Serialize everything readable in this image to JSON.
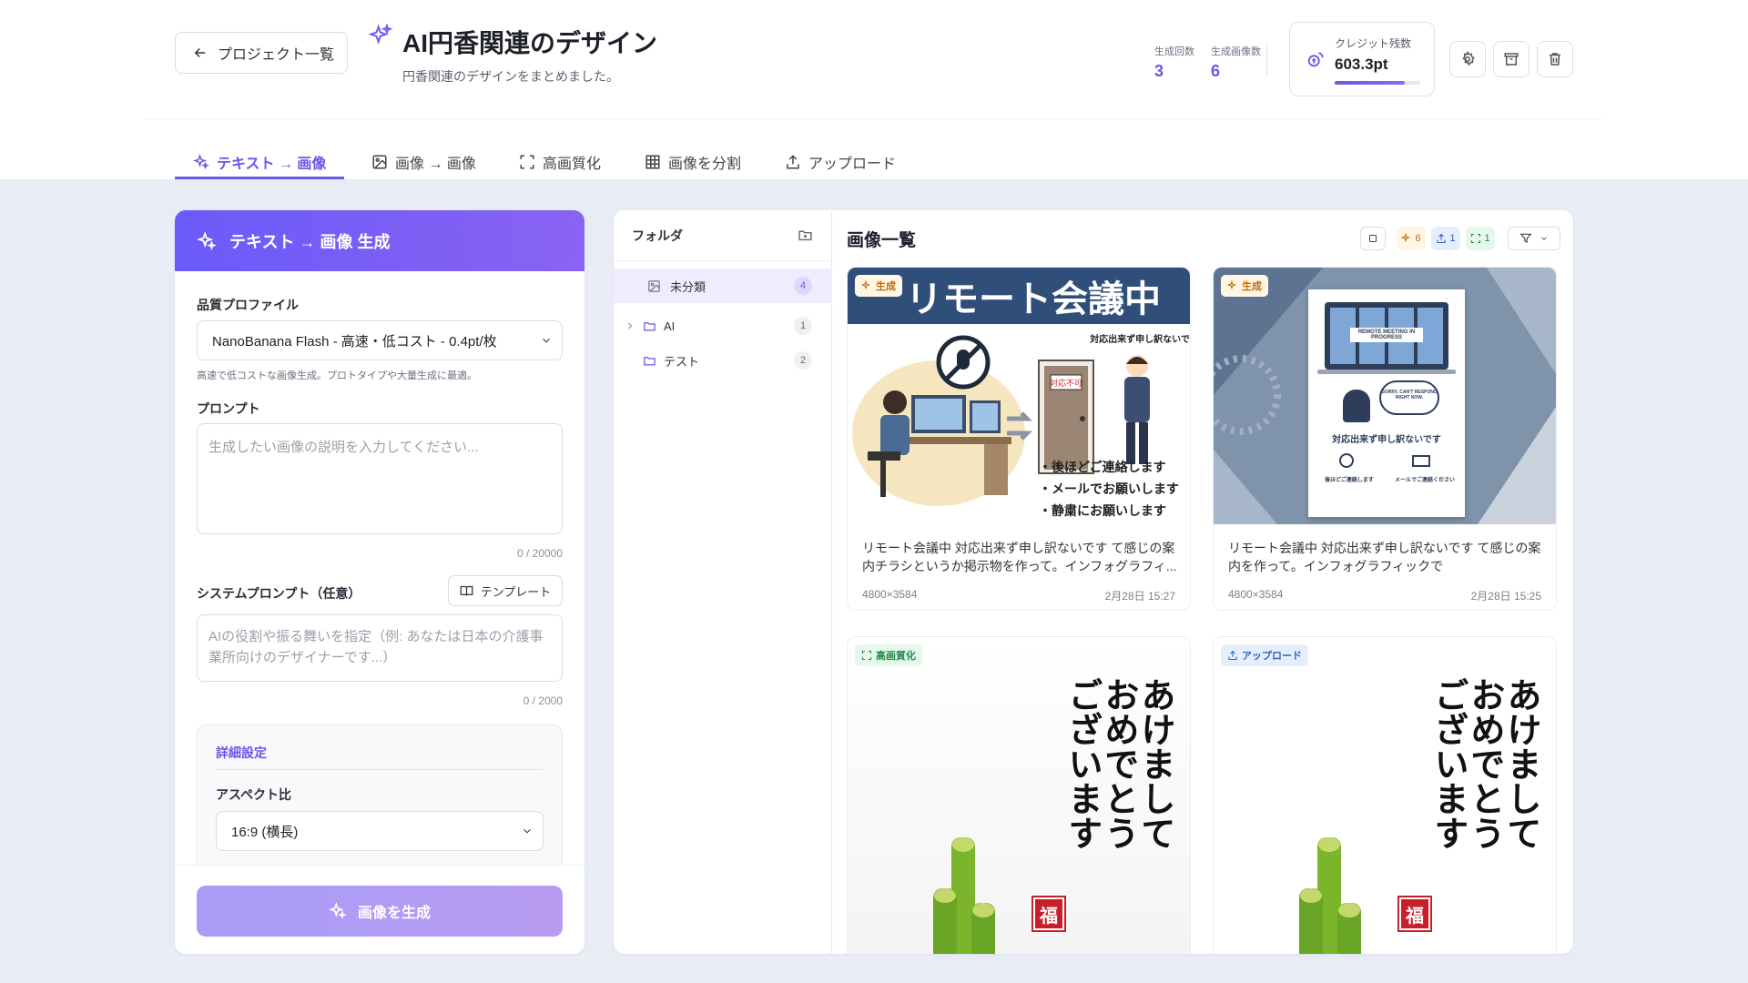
{
  "header": {
    "back_label": "プロジェクト一覧",
    "title": "AI円香関連のデザイン",
    "subtitle": "円香関連のデザインをまとめました。",
    "stats": [
      {
        "label": "生成回数",
        "value": "3"
      },
      {
        "label": "生成画像数",
        "value": "6"
      }
    ],
    "credit": {
      "label": "クレジット残数",
      "value": "603.3pt",
      "fill_fraction": 0.82
    },
    "actions": [
      "settings-icon",
      "archive-icon",
      "trash-icon"
    ]
  },
  "tabs": [
    {
      "label": "テキスト → 画像",
      "icon": "sparkles-icon",
      "active": true
    },
    {
      "label": "画像 → 画像",
      "icon": "image-icon"
    },
    {
      "label": "高画質化",
      "icon": "expand-icon"
    },
    {
      "label": "画像を分割",
      "icon": "grid-icon"
    },
    {
      "label": "アップロード",
      "icon": "upload-icon"
    }
  ],
  "generator": {
    "header": "テキスト → 画像 生成",
    "quality_label": "品質プロファイル",
    "quality_value": "NanoBanana Flash - 高速・低コスト - 0.4pt/枚",
    "quality_hint": "高速で低コストな画像生成。プロトタイプや大量生成に最適。",
    "prompt_label": "プロンプト",
    "prompt_placeholder": "生成したい画像の説明を入力してください...",
    "prompt_counter": "0 / 20000",
    "system_label": "システムプロンプト（任意）",
    "template_button": "テンプレート",
    "system_placeholder": "AIの役割や振る舞いを指定（例: あなたは日本の介護事業所向けのデザイナーです...）",
    "system_counter": "0 / 2000",
    "advanced_title": "詳細設定",
    "aspect_label": "アスペクト比",
    "aspect_value": "16:9 (横長)",
    "generate_button": "画像を生成"
  },
  "folders": {
    "title": "フォルダ",
    "items": [
      {
        "name": "未分類",
        "count": "4",
        "selected": true
      },
      {
        "name": "AI",
        "count": "1"
      },
      {
        "name": "テスト",
        "count": "2"
      }
    ]
  },
  "gallery": {
    "title": "画像一覧",
    "filters": [
      {
        "icon": "sparkles-icon",
        "count": "6"
      },
      {
        "icon": "upload-icon",
        "count": "1"
      },
      {
        "icon": "expand-icon",
        "count": "1"
      }
    ],
    "cards": [
      {
        "badge": "生成",
        "description": "リモート会議中 対応出来ず申し訳ないです て感じの案内チラシというか掲示物を作って。インフォグラフィ...",
        "dimensions": "4800×3584",
        "date": "2月28日 15:27",
        "image_text": {
          "title": "リモート会議中",
          "bubble": "対応出来ず申し訳ないです",
          "door_sign": "対応不可",
          "bullets": [
            "・後ほどご連絡します",
            "・メールでお願いします",
            "・静粛にお願いします"
          ]
        }
      },
      {
        "badge": "生成",
        "description": "リモート会議中 対応出来ず申し訳ないです て感じの案内を作って。インフォグラフィックで",
        "dimensions": "4800×3584",
        "date": "2月28日 15:25",
        "image_text": {
          "screen": "REMOTE MEETING IN PROGRESS",
          "bubble": "SORRY, CAN'T RESPOND RIGHT NOW.",
          "main": "対応出来ず申し訳ないです",
          "left": "後ほどご連絡します",
          "right": "メールでご連絡ください"
        }
      },
      {
        "badge": "高画質化",
        "image_text": {
          "lines": [
            "あけまして",
            "おめでとう",
            "ございます"
          ],
          "seal": "福"
        }
      },
      {
        "badge": "アップロード",
        "image_text": {
          "lines": [
            "あけまして",
            "おめでとう",
            "ございます"
          ],
          "seal": "福"
        }
      }
    ]
  },
  "colors": {
    "accent": "#6d55e8",
    "background": "#e8ecf5"
  }
}
